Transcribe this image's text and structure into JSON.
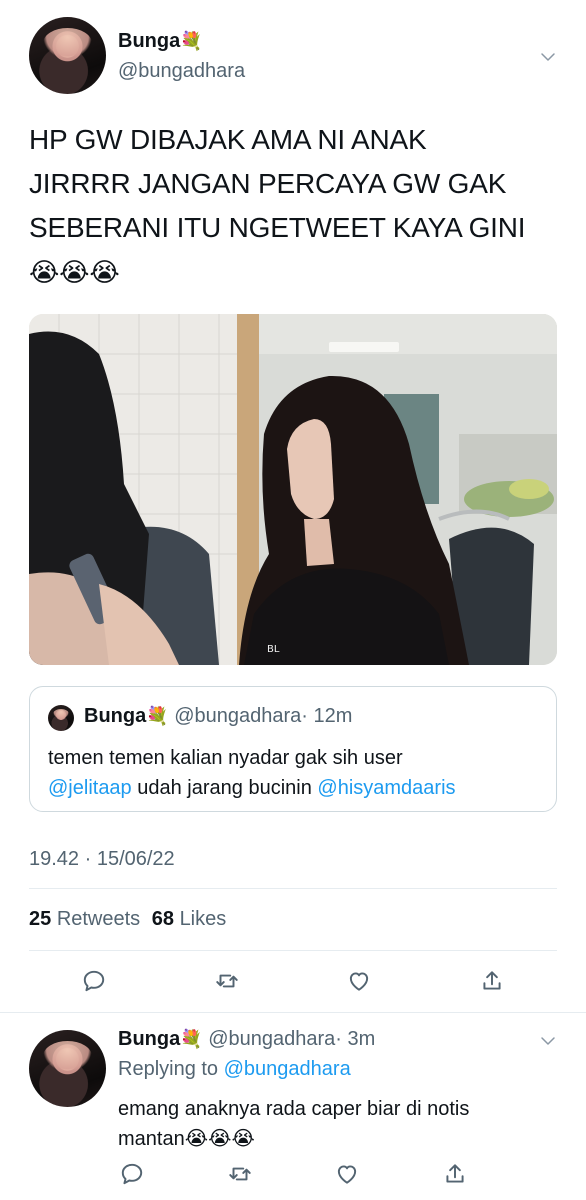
{
  "tweet": {
    "author_name": "Bunga",
    "author_emoji": "💐",
    "author_handle": "@bungadhara",
    "text_line1": "HP GW DIBAJAK AMA NI ANAK",
    "text_line2": "JIRRRR JANGAN PERCAYA GW GAK",
    "text_line3": "SEBERANI ITU NGETWEET KAYA GINI",
    "text_emojis": "😭😭😭",
    "timestamp": "19.42 · 15/06/22",
    "retweet_count": "25",
    "retweet_label": "Retweets",
    "like_count": "68",
    "like_label": "Likes"
  },
  "quote": {
    "author_name": "Bunga",
    "author_emoji": "💐",
    "author_handle": "@bungadhara",
    "time": "· 12m",
    "text_part1": "temen temen kalian nyadar gak sih user",
    "mention1": "@jelitaap",
    "text_part2": " udah jarang bucinin ",
    "mention2": "@hisyamdaaris"
  },
  "reply": {
    "author_name": "Bunga",
    "author_emoji": "💐",
    "author_handle": "@bungadhara",
    "time": "· 3m",
    "replying_label": "Replying to",
    "replying_to": "@bungadhara",
    "text_line1": "emang anaknya rada caper biar di notis",
    "text_line2": "mantan",
    "text_emojis": "😭😭😭"
  },
  "icons": [
    "chevron-down-icon",
    "reply-icon",
    "retweet-icon",
    "like-icon",
    "share-icon"
  ],
  "colors": {
    "accent": "#1d9bf0",
    "secondary_text": "#536471",
    "border": "#cfd9de"
  }
}
